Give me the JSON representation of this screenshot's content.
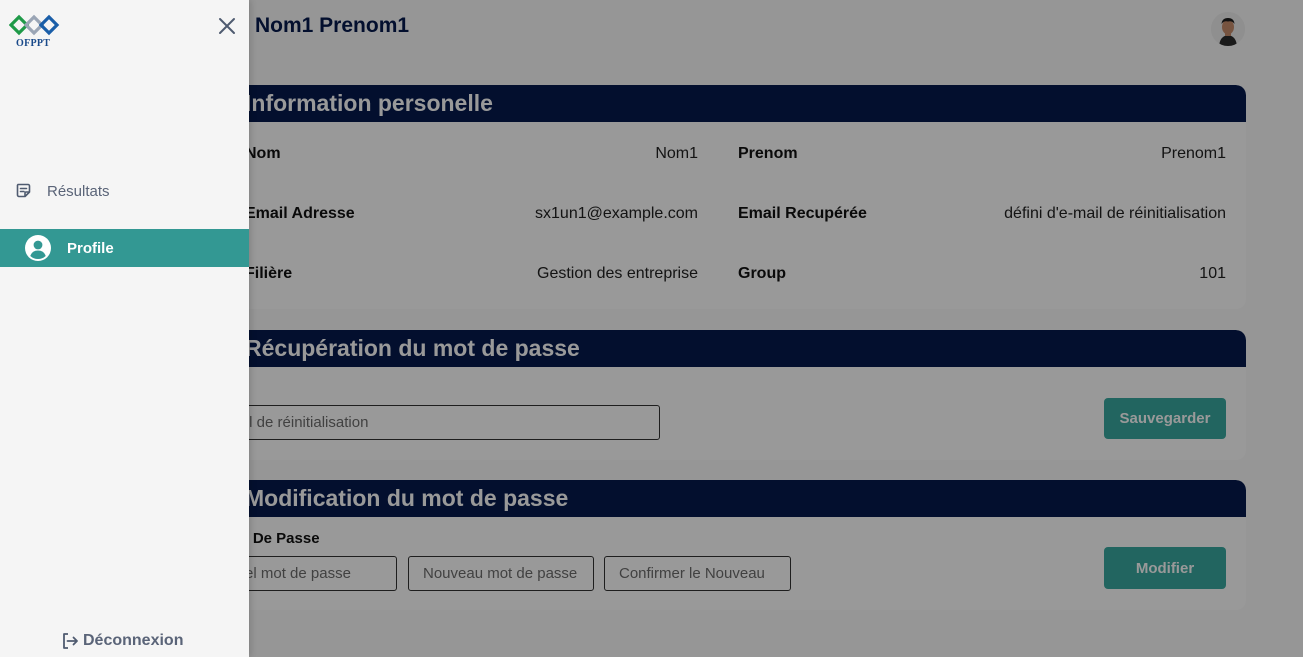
{
  "header": {
    "user_name": "Nom1 Prenom1"
  },
  "info_card": {
    "title": "Information personelle",
    "fields": [
      {
        "label": "Nom",
        "value": "Nom1"
      },
      {
        "label": "Prenom",
        "value": "Prenom1"
      },
      {
        "label": "Email Adresse",
        "value": "sx1un1@example.com"
      },
      {
        "label": "Email Recupérée",
        "value": "défini d'e-mail de réinitialisation"
      },
      {
        "label": "Filière",
        "value": "Gestion des entreprise"
      },
      {
        "label": "Group",
        "value": "101"
      }
    ]
  },
  "recovery_card": {
    "title": "Récupération du mot de passe",
    "email_placeholder": "Email de réinitialisation",
    "save_label": "Sauvegarder"
  },
  "password_card": {
    "title": "Modification du mot de passe",
    "section_label": "Mot De Passe",
    "current_placeholder": "Actuel mot de passe",
    "new_placeholder": "Nouveau mot de passe",
    "confirm_placeholder": "Confirmer le Nouveau",
    "modify_label": "Modifier"
  },
  "sidebar": {
    "logo_text": "OFPPT",
    "items": [
      {
        "label": "Résultats",
        "icon": "results-icon",
        "active": false
      },
      {
        "label": "Profile",
        "icon": "user-circle-icon",
        "active": true
      }
    ],
    "logout_label": "Déconnexion"
  },
  "colors": {
    "navy": "#061a4e",
    "teal": "#339893",
    "button_teal": "#3aa9a0"
  }
}
